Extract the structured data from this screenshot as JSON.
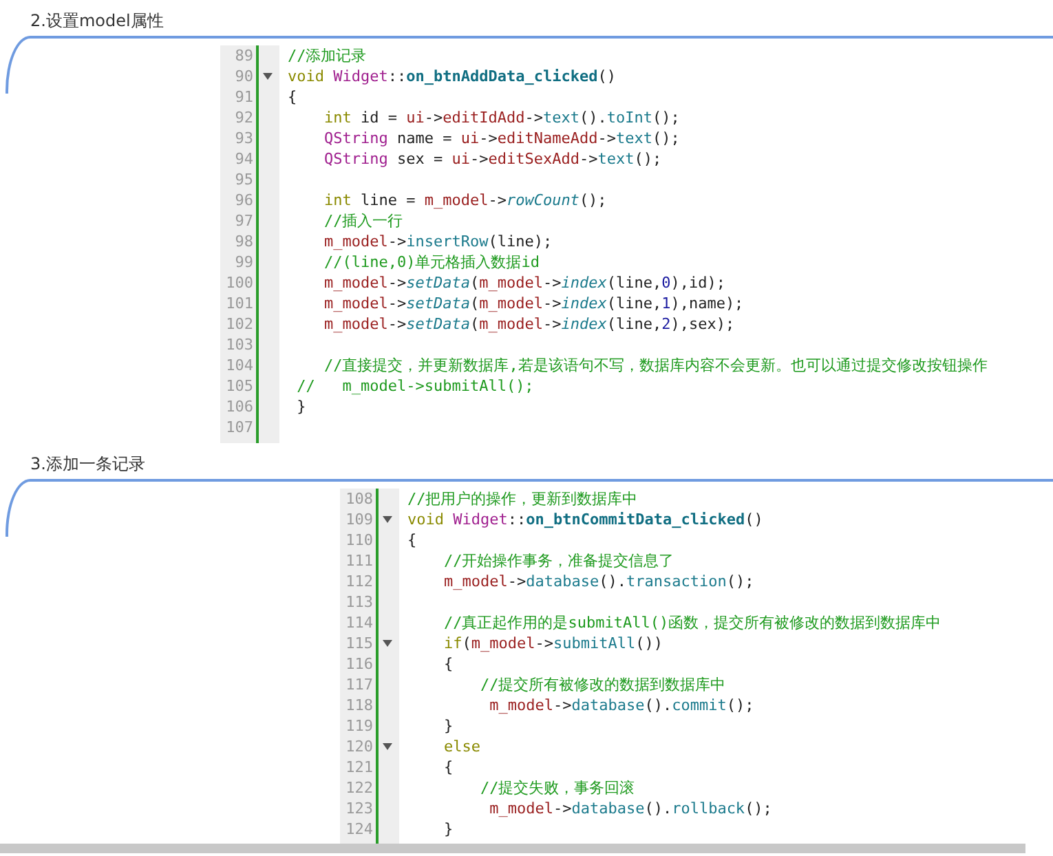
{
  "sections": [
    {
      "heading": "2.设置model属性",
      "lines": [
        {
          "no": "89",
          "fold": false,
          "tokens": [
            {
              "kind": "comment",
              "text": "//添加记录"
            }
          ]
        },
        {
          "no": "90",
          "fold": true,
          "tokens": [
            {
              "kind": "keyword",
              "text": "void "
            },
            {
              "kind": "type",
              "text": "Widget"
            },
            {
              "kind": "plain",
              "text": "::"
            },
            {
              "kind": "function",
              "text": "on_btnAddData_clicked"
            },
            {
              "kind": "plain",
              "text": "()"
            }
          ]
        },
        {
          "no": "91",
          "fold": false,
          "tokens": [
            {
              "kind": "plain",
              "text": "{"
            }
          ]
        },
        {
          "no": "92",
          "fold": false,
          "tokens": [
            {
              "kind": "keyword",
              "text": "    int"
            },
            {
              "kind": "plain",
              "text": " id = "
            },
            {
              "kind": "member",
              "text": "ui"
            },
            {
              "kind": "plain",
              "text": "->"
            },
            {
              "kind": "member",
              "text": "editIdAdd"
            },
            {
              "kind": "plain",
              "text": "->"
            },
            {
              "kind": "method",
              "text": "text"
            },
            {
              "kind": "plain",
              "text": "()."
            },
            {
              "kind": "method",
              "text": "toInt"
            },
            {
              "kind": "plain",
              "text": "();"
            }
          ]
        },
        {
          "no": "93",
          "fold": false,
          "tokens": [
            {
              "kind": "type",
              "text": "    QString"
            },
            {
              "kind": "plain",
              "text": " name = "
            },
            {
              "kind": "member",
              "text": "ui"
            },
            {
              "kind": "plain",
              "text": "->"
            },
            {
              "kind": "member",
              "text": "editNameAdd"
            },
            {
              "kind": "plain",
              "text": "->"
            },
            {
              "kind": "method",
              "text": "text"
            },
            {
              "kind": "plain",
              "text": "();"
            }
          ]
        },
        {
          "no": "94",
          "fold": false,
          "tokens": [
            {
              "kind": "type",
              "text": "    QString"
            },
            {
              "kind": "plain",
              "text": " sex = "
            },
            {
              "kind": "member",
              "text": "ui"
            },
            {
              "kind": "plain",
              "text": "->"
            },
            {
              "kind": "member",
              "text": "editSexAdd"
            },
            {
              "kind": "plain",
              "text": "->"
            },
            {
              "kind": "method",
              "text": "text"
            },
            {
              "kind": "plain",
              "text": "();"
            }
          ]
        },
        {
          "no": "95",
          "fold": false
        },
        {
          "no": "96",
          "fold": false,
          "tokens": [
            {
              "kind": "keyword",
              "text": "    int"
            },
            {
              "kind": "plain",
              "text": " line = "
            },
            {
              "kind": "member",
              "text": "m_model"
            },
            {
              "kind": "plain",
              "text": "->"
            },
            {
              "kind": "virtual",
              "text": "rowCount"
            },
            {
              "kind": "plain",
              "text": "();"
            }
          ]
        },
        {
          "no": "97",
          "fold": false,
          "tokens": [
            {
              "kind": "comment",
              "text": "    //插入一行"
            }
          ]
        },
        {
          "no": "98",
          "fold": false,
          "tokens": [
            {
              "kind": "member",
              "text": "    m_model"
            },
            {
              "kind": "plain",
              "text": "->"
            },
            {
              "kind": "method",
              "text": "insertRow"
            },
            {
              "kind": "plain",
              "text": "(line);"
            }
          ]
        },
        {
          "no": "99",
          "fold": false,
          "tokens": [
            {
              "kind": "comment",
              "text": "    //(line,0)单元格插入数据id"
            }
          ]
        },
        {
          "no": "100",
          "fold": false,
          "tokens": [
            {
              "kind": "member",
              "text": "    m_model"
            },
            {
              "kind": "plain",
              "text": "->"
            },
            {
              "kind": "virtual",
              "text": "setData"
            },
            {
              "kind": "plain",
              "text": "("
            },
            {
              "kind": "member",
              "text": "m_model"
            },
            {
              "kind": "plain",
              "text": "->"
            },
            {
              "kind": "virtual",
              "text": "index"
            },
            {
              "kind": "plain",
              "text": "(line,"
            },
            {
              "kind": "number",
              "text": "0"
            },
            {
              "kind": "plain",
              "text": "),id);"
            }
          ]
        },
        {
          "no": "101",
          "fold": false,
          "tokens": [
            {
              "kind": "member",
              "text": "    m_model"
            },
            {
              "kind": "plain",
              "text": "->"
            },
            {
              "kind": "virtual",
              "text": "setData"
            },
            {
              "kind": "plain",
              "text": "("
            },
            {
              "kind": "member",
              "text": "m_model"
            },
            {
              "kind": "plain",
              "text": "->"
            },
            {
              "kind": "virtual",
              "text": "index"
            },
            {
              "kind": "plain",
              "text": "(line,"
            },
            {
              "kind": "number",
              "text": "1"
            },
            {
              "kind": "plain",
              "text": "),name);"
            }
          ]
        },
        {
          "no": "102",
          "fold": false,
          "tokens": [
            {
              "kind": "member",
              "text": "    m_model"
            },
            {
              "kind": "plain",
              "text": "->"
            },
            {
              "kind": "virtual",
              "text": "setData"
            },
            {
              "kind": "plain",
              "text": "("
            },
            {
              "kind": "member",
              "text": "m_model"
            },
            {
              "kind": "plain",
              "text": "->"
            },
            {
              "kind": "virtual",
              "text": "index"
            },
            {
              "kind": "plain",
              "text": "(line,"
            },
            {
              "kind": "number",
              "text": "2"
            },
            {
              "kind": "plain",
              "text": "),sex);"
            }
          ]
        },
        {
          "no": "103",
          "fold": false
        },
        {
          "no": "104",
          "fold": false,
          "tokens": [
            {
              "kind": "comment",
              "text": "    //直接提交，并更新数据库,若是该语句不写，数据库内容不会更新。也可以通过提交修改按钮操作"
            }
          ]
        },
        {
          "no": "105",
          "fold": false,
          "tokens": [
            {
              "kind": "comment",
              "text": " //   m_model->submitAll();"
            }
          ]
        },
        {
          "no": "106",
          "fold": false,
          "tokens": [
            {
              "kind": "plain",
              "text": " }"
            }
          ]
        },
        {
          "no": "107",
          "fold": false
        }
      ]
    },
    {
      "heading": "3.添加一条记录",
      "lines": [
        {
          "no": "108",
          "fold": false,
          "tokens": [
            {
              "kind": "comment",
              "text": "//把用户的操作，更新到数据库中"
            }
          ]
        },
        {
          "no": "109",
          "fold": true,
          "tokens": [
            {
              "kind": "keyword",
              "text": "void "
            },
            {
              "kind": "type",
              "text": "Widget"
            },
            {
              "kind": "plain",
              "text": "::"
            },
            {
              "kind": "function",
              "text": "on_btnCommitData_clicked"
            },
            {
              "kind": "plain",
              "text": "()"
            }
          ]
        },
        {
          "no": "110",
          "fold": false,
          "tokens": [
            {
              "kind": "plain",
              "text": "{"
            }
          ]
        },
        {
          "no": "111",
          "fold": false,
          "tokens": [
            {
              "kind": "comment",
              "text": "    //开始操作事务，准备提交信息了"
            }
          ]
        },
        {
          "no": "112",
          "fold": false,
          "tokens": [
            {
              "kind": "member",
              "text": "    m_model"
            },
            {
              "kind": "plain",
              "text": "->"
            },
            {
              "kind": "method",
              "text": "database"
            },
            {
              "kind": "plain",
              "text": "()."
            },
            {
              "kind": "method",
              "text": "transaction"
            },
            {
              "kind": "plain",
              "text": "();"
            }
          ]
        },
        {
          "no": "113",
          "fold": false
        },
        {
          "no": "114",
          "fold": false,
          "tokens": [
            {
              "kind": "comment",
              "text": "    //真正起作用的是submitAll()函数，提交所有被修改的数据到数据库中"
            }
          ]
        },
        {
          "no": "115",
          "fold": true,
          "tokens": [
            {
              "kind": "keyword",
              "text": "    if"
            },
            {
              "kind": "plain",
              "text": "("
            },
            {
              "kind": "member",
              "text": "m_model"
            },
            {
              "kind": "plain",
              "text": "->"
            },
            {
              "kind": "method",
              "text": "submitAll"
            },
            {
              "kind": "plain",
              "text": "())"
            }
          ]
        },
        {
          "no": "116",
          "fold": false,
          "tokens": [
            {
              "kind": "plain",
              "text": "    {"
            }
          ]
        },
        {
          "no": "117",
          "fold": false,
          "tokens": [
            {
              "kind": "comment",
              "text": "        //提交所有被修改的数据到数据库中"
            }
          ]
        },
        {
          "no": "118",
          "fold": false,
          "tokens": [
            {
              "kind": "member",
              "text": "         m_model"
            },
            {
              "kind": "plain",
              "text": "->"
            },
            {
              "kind": "method",
              "text": "database"
            },
            {
              "kind": "plain",
              "text": "()."
            },
            {
              "kind": "method",
              "text": "commit"
            },
            {
              "kind": "plain",
              "text": "();"
            }
          ]
        },
        {
          "no": "119",
          "fold": false,
          "tokens": [
            {
              "kind": "plain",
              "text": "    }"
            }
          ]
        },
        {
          "no": "120",
          "fold": true,
          "tokens": [
            {
              "kind": "keyword",
              "text": "    else"
            }
          ]
        },
        {
          "no": "121",
          "fold": false,
          "tokens": [
            {
              "kind": "plain",
              "text": "    {"
            }
          ]
        },
        {
          "no": "122",
          "fold": false,
          "tokens": [
            {
              "kind": "comment",
              "text": "        //提交失败，事务回滚"
            }
          ]
        },
        {
          "no": "123",
          "fold": false,
          "tokens": [
            {
              "kind": "member",
              "text": "         m_model"
            },
            {
              "kind": "plain",
              "text": "->"
            },
            {
              "kind": "method",
              "text": "database"
            },
            {
              "kind": "plain",
              "text": "()."
            },
            {
              "kind": "method",
              "text": "rollback"
            },
            {
              "kind": "plain",
              "text": "();"
            }
          ]
        },
        {
          "no": "124",
          "fold": false,
          "tokens": [
            {
              "kind": "plain",
              "text": "    }"
            }
          ]
        }
      ]
    }
  ]
}
